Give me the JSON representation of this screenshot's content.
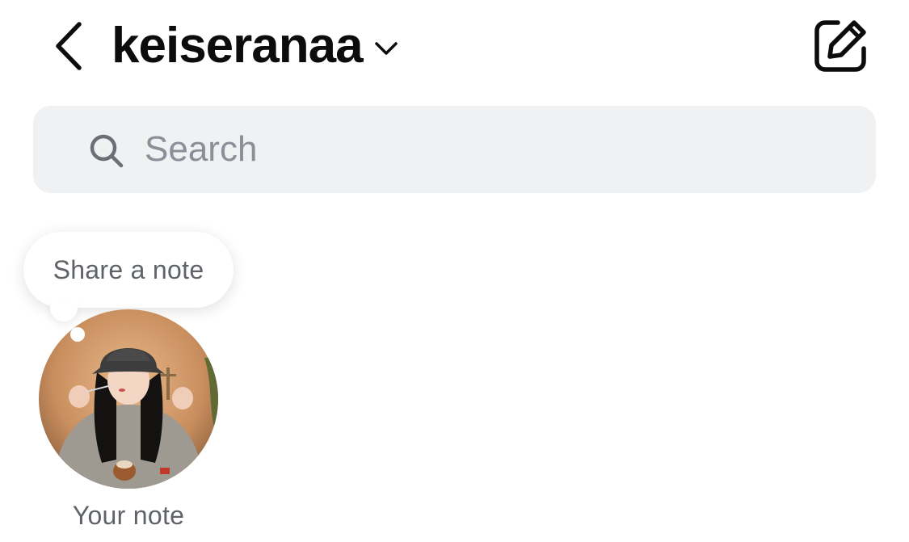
{
  "header": {
    "back_icon": "chevron-left-icon",
    "username": "keiseranaa",
    "switcher_icon": "chevron-down-icon",
    "compose_icon": "edit-square-icon"
  },
  "search": {
    "icon": "search-icon",
    "placeholder": "Search",
    "value": ""
  },
  "notes": {
    "bubble_text": "Share a note",
    "items": [
      {
        "label": "Your note",
        "avatar": "profile-photo"
      }
    ]
  },
  "colors": {
    "background": "#ffffff",
    "search_background": "#eff1f3",
    "text_primary": "#0c0c0c",
    "text_secondary": "#5f6368",
    "placeholder": "#8a8f98"
  }
}
